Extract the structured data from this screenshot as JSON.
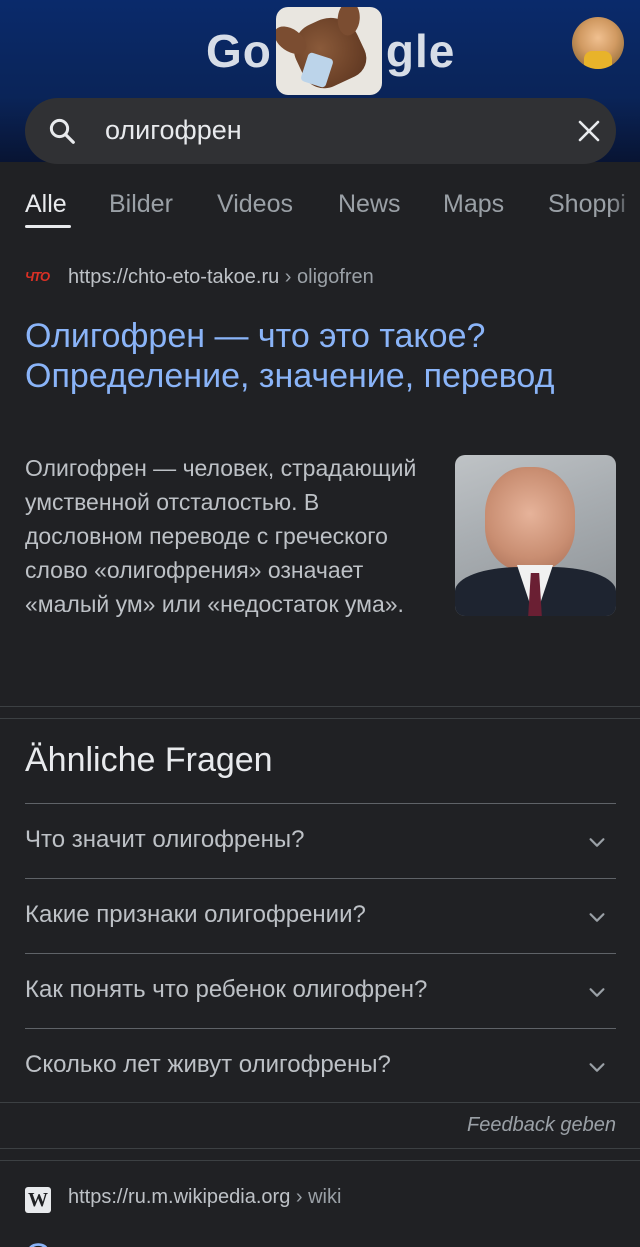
{
  "header": {
    "logo_left": "Go",
    "logo_right": "gle",
    "search": {
      "query": "олигофрен"
    }
  },
  "tabs": [
    {
      "label": "Alle",
      "active": true
    },
    {
      "label": "Bilder",
      "active": false
    },
    {
      "label": "Videos",
      "active": false
    },
    {
      "label": "News",
      "active": false
    },
    {
      "label": "Maps",
      "active": false
    },
    {
      "label": "Shoppi",
      "active": false
    }
  ],
  "result1": {
    "favicon_text": "ЧТО",
    "url": "https://chto-eto-takoe.ru",
    "breadcrumb": " › oligofren",
    "title": "Олигофрен — что это такое? Определение, значение, перевод",
    "snippet": "Олигофрен — человек, страдающий умственной отсталостью. В дословном переводе с греческого слово «олигофрения» означает «малый ум» или «недостаток ума»."
  },
  "related": {
    "title": "Ähnliche Fragen",
    "questions": [
      "Что значит олигофрены?",
      "Какие признаки олигофрении?",
      "Как понять что ребенок олигофрен?",
      "Сколько лет живут олигофрены?"
    ],
    "feedback": "Feedback geben"
  },
  "result2": {
    "favicon_text": "W",
    "url": "https://ru.m.wikipedia.org",
    "breadcrumb": " › wiki",
    "title_peek": "О"
  },
  "colors": {
    "link": "#8ab4f8",
    "background": "#202124",
    "header": "#0a2a6b"
  }
}
